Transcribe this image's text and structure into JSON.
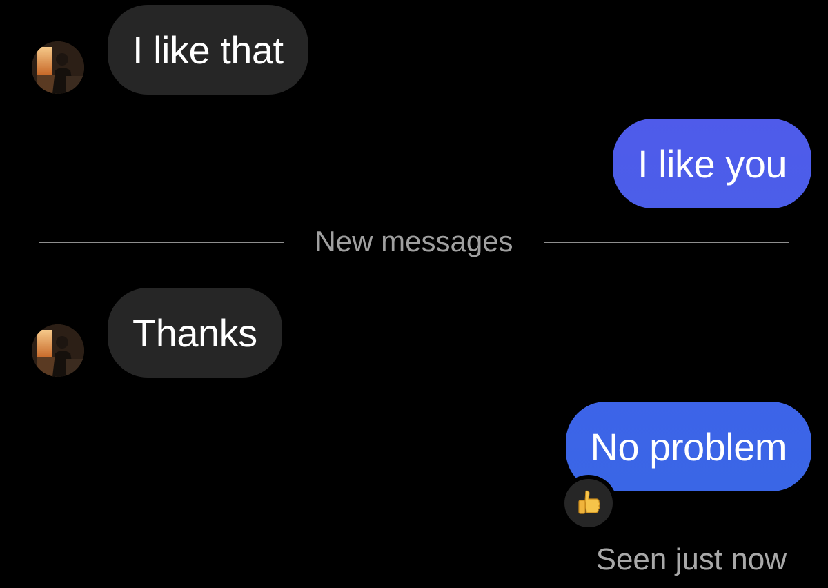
{
  "colors": {
    "background": "#000000",
    "incoming_bubble": "#262626",
    "outgoing_gradient_top": "#4f5bea",
    "outgoing_gradient_bottom": "#3a62e6",
    "divider": "#8e8e8e",
    "meta_text": "#a8a8a8"
  },
  "messages": [
    {
      "direction": "incoming",
      "text": "I like that",
      "has_avatar": true
    },
    {
      "direction": "outgoing",
      "text": "I like you"
    },
    {
      "direction": "incoming",
      "text": "Thanks",
      "has_avatar": true
    },
    {
      "direction": "outgoing",
      "text": "No problem",
      "reaction": "thumbs-up"
    }
  ],
  "divider": {
    "label": "New messages"
  },
  "status": {
    "seen": "Seen just now"
  },
  "icons": {
    "avatar": "avatar-photo",
    "reaction": "thumbs-up-icon"
  }
}
